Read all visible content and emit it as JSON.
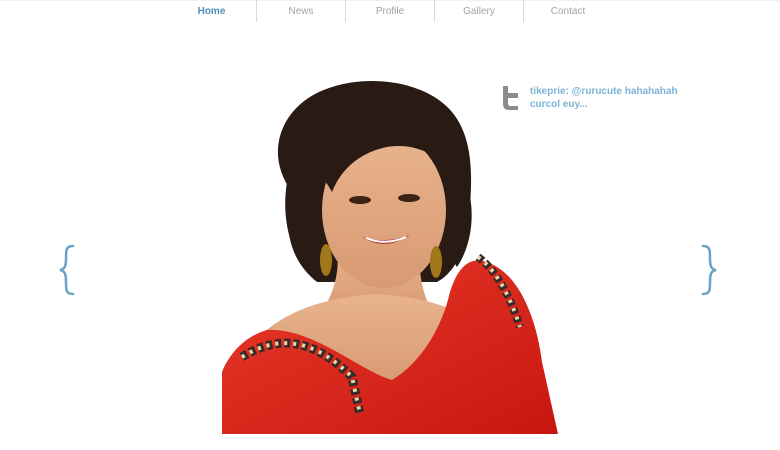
{
  "nav": {
    "items": [
      {
        "label": "Home",
        "active": true
      },
      {
        "label": "News",
        "active": false
      },
      {
        "label": "Profile",
        "active": false
      },
      {
        "label": "Gallery",
        "active": false
      },
      {
        "label": "Contact",
        "active": false
      }
    ]
  },
  "tweet": {
    "text": "tikeprie: @rurucute hahahahah curcol euy...",
    "icon": "twitter-icon"
  },
  "carousel": {
    "prev_icon": "left-brace-icon",
    "next_icon": "right-brace-icon"
  },
  "colors": {
    "accent": "#4f90bb",
    "tweet": "#7db3d6",
    "nav_inactive": "#a3a3a3",
    "dress": "#e0241c"
  }
}
